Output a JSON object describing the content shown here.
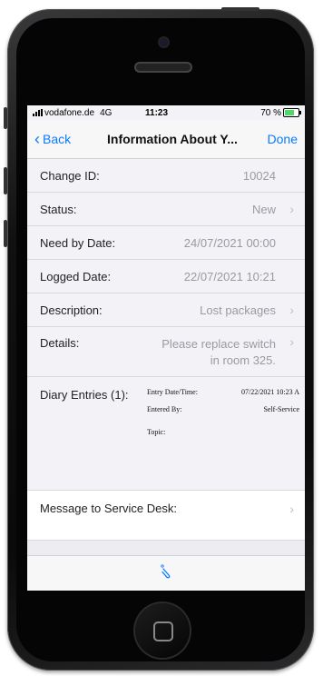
{
  "statusbar": {
    "carrier": "vodafone.de",
    "network": "4G",
    "time": "11:23",
    "battery": "70 %",
    "battery_level": 0.7
  },
  "navbar": {
    "back_label": "Back",
    "title": "Information About Y...",
    "done_label": "Done"
  },
  "fields": {
    "change_id": {
      "label": "Change ID:",
      "value": "10024"
    },
    "status": {
      "label": "Status:",
      "value": "New"
    },
    "need_by_date": {
      "label": "Need by Date:",
      "value": "24/07/2021 00:00"
    },
    "logged_date": {
      "label": "Logged Date:",
      "value": "22/07/2021 10:21"
    },
    "description": {
      "label": "Description:",
      "value": "Lost packages"
    },
    "details": {
      "label": "Details:",
      "value": "Please replace switch in room 325."
    }
  },
  "diary": {
    "label": "Diary Entries (1):",
    "entry_date_label": "Entry Date/Time:",
    "entry_date_value": "07/22/2021 10:23 A",
    "entered_by_label": "Entered By:",
    "entered_by_value": "Self-Service",
    "topic_label": "Topic:"
  },
  "message": {
    "label": "Message to Service Desk:"
  },
  "colors": {
    "accent": "#0a7aff",
    "battery": "#4cd964"
  },
  "icons": {
    "toolbar": "paperclip-icon",
    "chevron": "chevron-right-icon",
    "back": "chevron-left-icon"
  }
}
